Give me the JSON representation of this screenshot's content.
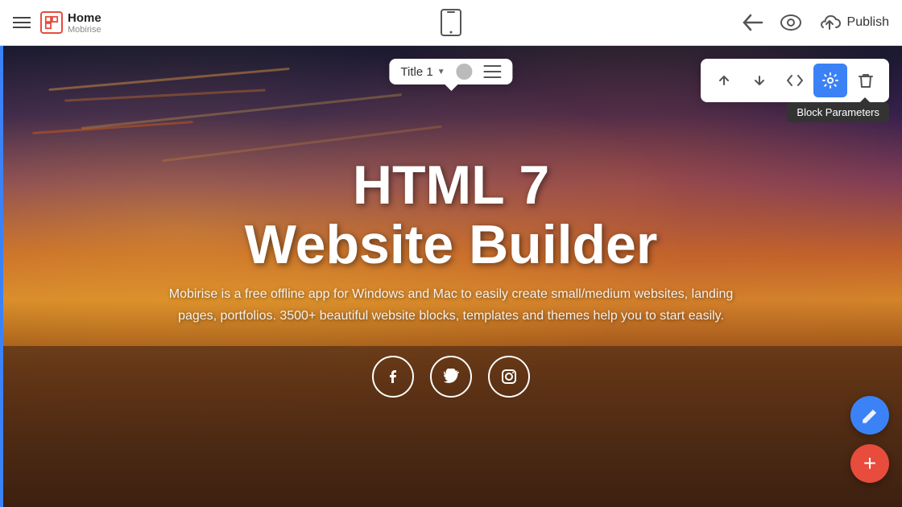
{
  "topbar": {
    "menu_label": "Menu",
    "app_name": "Home",
    "app_sub": "Mobirise",
    "phone_icon": "phone-icon",
    "back_icon": "←",
    "eye_icon": "👁",
    "cloud_icon": "☁",
    "publish_label": "Publish"
  },
  "block_toolbar": {
    "up_label": "↑",
    "down_label": "↓",
    "code_label": "</>",
    "settings_label": "⚙",
    "delete_label": "🗑",
    "params_tooltip": "Block Parameters"
  },
  "title_dropdown": {
    "label": "Title 1",
    "caret": "▼"
  },
  "hero": {
    "heading_line1": "HTML 7",
    "heading_line2": "Website Builder",
    "description": "Mobirise is a free offline app for Windows and Mac to easily create small/medium websites, landing pages, portfolios. 3500+ beautiful website blocks, templates and themes help you to start easily.",
    "social": {
      "facebook": "f",
      "twitter": "t",
      "instagram": "i"
    }
  },
  "fab": {
    "edit_icon": "✏",
    "add_icon": "+"
  }
}
